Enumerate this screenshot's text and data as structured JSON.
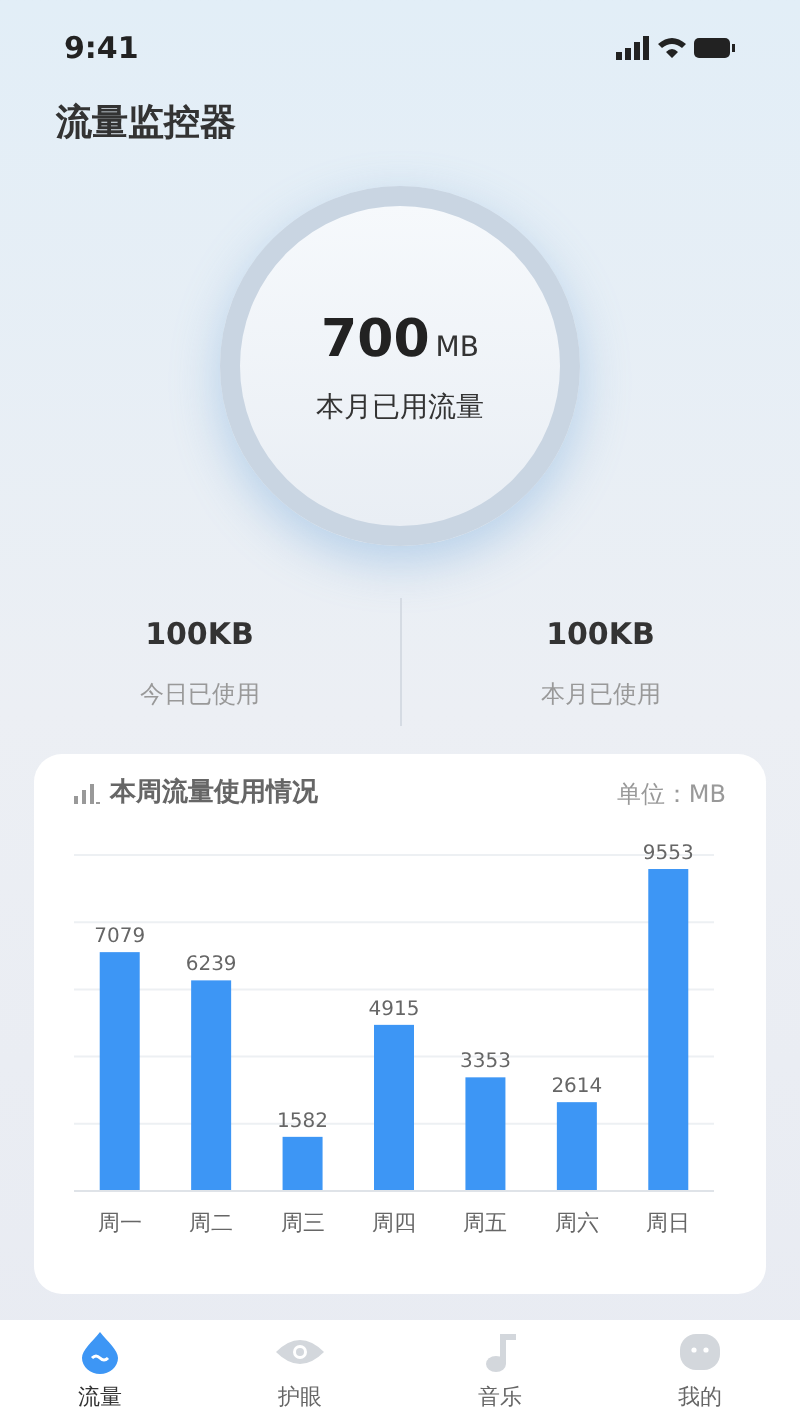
{
  "status_bar": {
    "time": "9:41"
  },
  "title": "流量监控器",
  "gauge": {
    "value": "700",
    "unit": "MB",
    "label": "本月已用流量"
  },
  "stats": [
    {
      "value": "100KB",
      "label": "今日已使用"
    },
    {
      "value": "100KB",
      "label": "本月已使用"
    }
  ],
  "weekly": {
    "title": "本周流量使用情况",
    "unit": "单位：MB",
    "chart_data": {
      "type": "bar",
      "categories": [
        "周一",
        "周二",
        "周三",
        "周四",
        "周五",
        "周六",
        "周日"
      ],
      "values": [
        7079,
        6239,
        1582,
        4915,
        3353,
        2614,
        9553
      ],
      "ylim": [
        0,
        10000
      ],
      "data_labels": true,
      "value_labels": [
        "7079",
        "6239",
        "1582",
        "4915",
        "3353",
        "2614",
        "9553"
      ]
    }
  },
  "tabs": [
    {
      "label": "流量",
      "kind": "drop",
      "selected": true
    },
    {
      "label": "护眼",
      "kind": "eye",
      "selected": false
    },
    {
      "label": "音乐",
      "kind": "note",
      "selected": false
    },
    {
      "label": "我的",
      "kind": "face",
      "selected": false
    }
  ]
}
